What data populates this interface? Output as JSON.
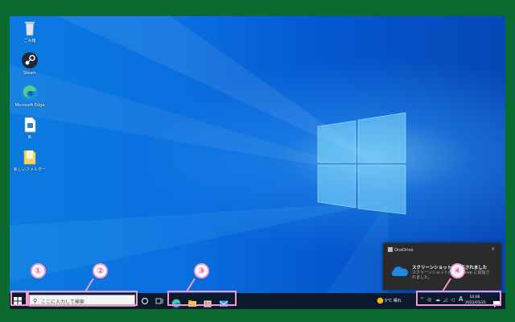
{
  "desktop_icons": [
    {
      "label": "ごみ箱",
      "icon": "recycle-bin-icon"
    },
    {
      "label": "Steam",
      "icon": "steam-icon"
    },
    {
      "label": "Microsoft Edge",
      "icon": "edge-icon"
    },
    {
      "label": "新",
      "icon": "document-icon"
    },
    {
      "label": "新しいフォルダー",
      "icon": "folder-icon"
    }
  ],
  "taskbar": {
    "search_placeholder": "ここに入力して検索",
    "weather": "5°C 晴れ",
    "clock_time": "10:06",
    "clock_date": "2022/01/21",
    "ime": "A"
  },
  "toast": {
    "app_name": "OneDrive",
    "title": "スクリーンショットが保存されました",
    "body": "スクリーンショットが OneDrive に追加されました。",
    "close": "×"
  },
  "annotations": [
    "①",
    "②",
    "③",
    "④"
  ],
  "colors": {
    "annotation": "#f59ac8",
    "taskbar": "#0c1a2e",
    "frame": "#0b6a2f"
  }
}
